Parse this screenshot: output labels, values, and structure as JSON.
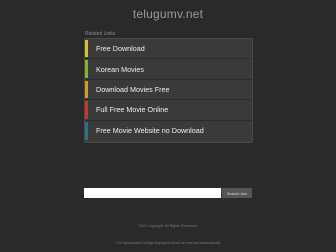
{
  "site": {
    "domain": "telugumv.net"
  },
  "related": {
    "title": "Related Links",
    "links": [
      {
        "label": "Free Download",
        "color": "#d3c233"
      },
      {
        "label": "Korean Movies",
        "color": "#7fb23a"
      },
      {
        "label": "Download Movies Free",
        "color": "#d09a2a"
      },
      {
        "label": "Full Free Movie Online",
        "color": "#c0392b"
      },
      {
        "label": "Free Movie Website no Download",
        "color": "#2f6f83"
      }
    ]
  },
  "search": {
    "button_label": "Search Ads",
    "placeholder": ""
  },
  "footer": {
    "copyright": "2021 Copyright. All Rights Reserved.",
    "disclaimer": "The Sponsored Listings displayed above are served automatically"
  }
}
